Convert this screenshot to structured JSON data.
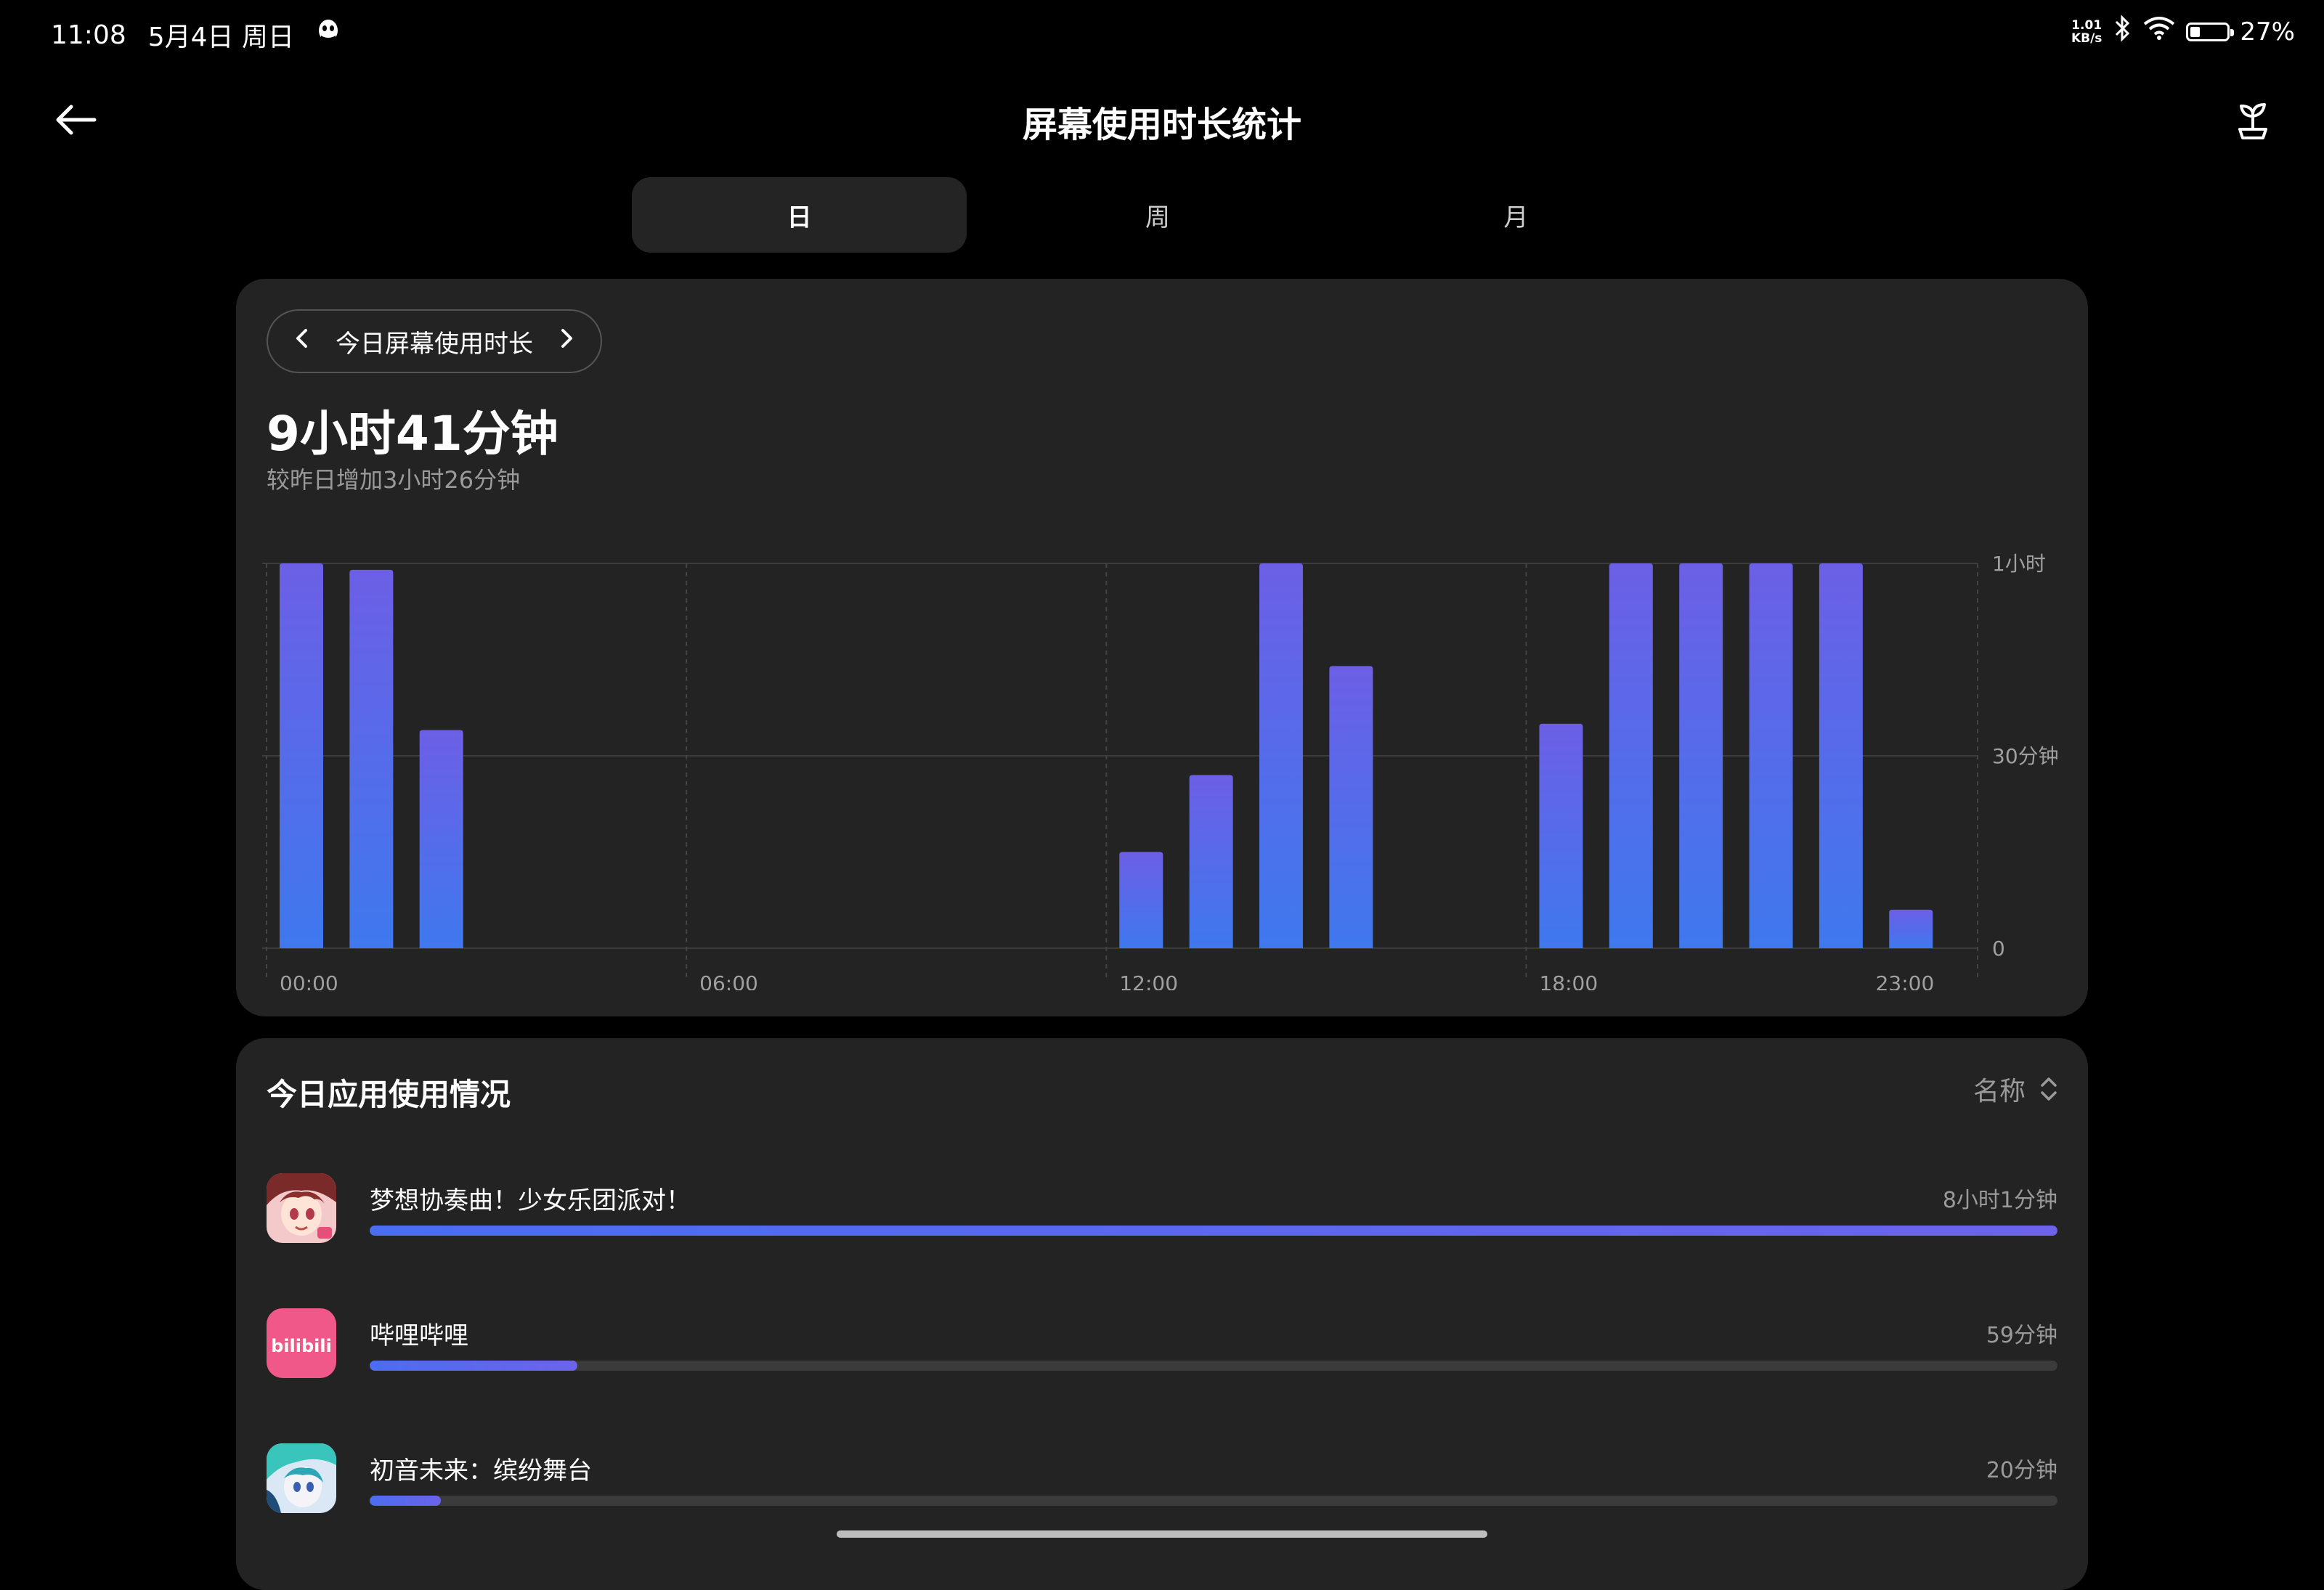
{
  "status": {
    "time": "11:08",
    "date": "5月4日 周日",
    "net_speed_value": "1.01",
    "net_speed_unit": "KB/s",
    "battery": "27%",
    "battery_level": 0.27,
    "notification_icon": "qq-icon"
  },
  "header": {
    "title": "屏幕使用时长统计",
    "back_icon": "back-arrow-icon",
    "action_icon": "sprout-icon"
  },
  "tabs": [
    {
      "label": "日",
      "active": true
    },
    {
      "label": "周",
      "active": false
    },
    {
      "label": "月",
      "active": false
    }
  ],
  "summary": {
    "range_label": "今日屏幕使用时长",
    "total": "9小时41分钟",
    "compare": "较昨日增加3小时26分钟"
  },
  "chart_data": {
    "type": "bar",
    "unit": "minutes",
    "hours": [
      0,
      1,
      2,
      3,
      4,
      5,
      6,
      7,
      8,
      9,
      10,
      11,
      12,
      13,
      14,
      15,
      16,
      17,
      18,
      19,
      20,
      21,
      22,
      23
    ],
    "values": [
      60,
      59,
      34,
      0,
      0,
      0,
      0,
      0,
      0,
      0,
      0,
      0,
      15,
      27,
      60,
      44,
      0,
      0,
      35,
      60,
      60,
      60,
      60,
      6
    ],
    "ylim": [
      0,
      60
    ],
    "y_ticks": [
      {
        "value": 0,
        "label": "0"
      },
      {
        "value": 30,
        "label": "30分钟"
      },
      {
        "value": 60,
        "label": "1小时"
      }
    ],
    "x_ticks": [
      {
        "hour": 0,
        "label": "00:00"
      },
      {
        "hour": 6,
        "label": "06:00"
      },
      {
        "hour": 12,
        "label": "12:00"
      },
      {
        "hour": 18,
        "label": "18:00"
      },
      {
        "hour": 23,
        "label": "23:00"
      }
    ],
    "colors": {
      "bar_top": "#6C5FE6",
      "bar_bottom": "#3F78EE",
      "grid": "#3c3c3c"
    }
  },
  "apps": {
    "title": "今日应用使用情况",
    "sort_label": "名称",
    "items": [
      {
        "name": "梦想协奏曲！少女乐团派对！",
        "time": "8小时1分钟",
        "ratio": 1.0,
        "icon": "bandori-app-icon"
      },
      {
        "name": "哔哩哔哩",
        "time": "59分钟",
        "ratio": 0.123,
        "icon": "bilibili-app-icon",
        "icon_text": "bilibili"
      },
      {
        "name": "初音未来：缤纷舞台",
        "time": "20分钟",
        "ratio": 0.042,
        "icon": "project-sekai-app-icon"
      }
    ]
  }
}
